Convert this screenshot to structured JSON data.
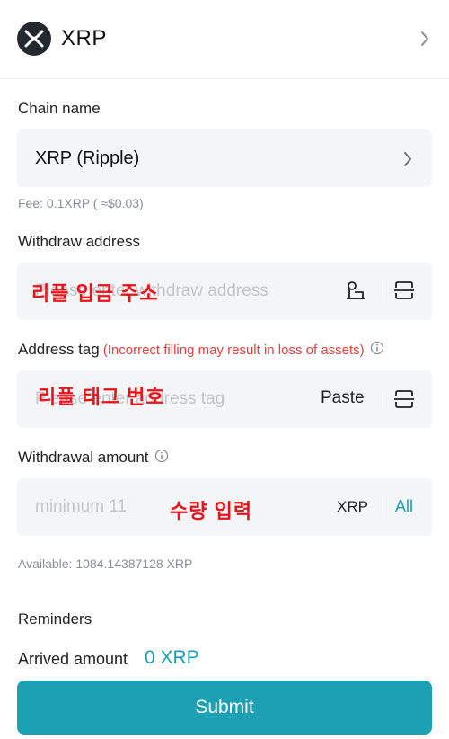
{
  "header": {
    "coin_name": "XRP",
    "logo_icon": "xrp-logo",
    "chevron_icon": "chevron-right-icon"
  },
  "chain": {
    "label": "Chain name",
    "value": "XRP (Ripple)",
    "fee": "Fee: 0.1XRP ( ≈$0.03)"
  },
  "withdraw_address": {
    "label": "Withdraw address",
    "placeholder": "Please enter withdraw address",
    "overlay_annotation": "리플 입금 주소",
    "address_book_icon": "address-book-icon",
    "scan_icon": "scan-icon"
  },
  "address_tag": {
    "label": "Address tag",
    "warning": "(Incorrect filling may result in loss of assets)",
    "placeholder": "Please enter address tag",
    "overlay_annotation": "리플 태그 번호",
    "paste_label": "Paste",
    "scan_icon": "scan-icon"
  },
  "withdrawal_amount": {
    "label": "Withdrawal amount",
    "placeholder": "minimum 11",
    "overlay_annotation": "수량 입력",
    "unit": "XRP",
    "all_label": "All",
    "available": "Available: 1084.14387128 XRP"
  },
  "reminders": {
    "label": "Reminders"
  },
  "footer": {
    "arrived_label": "Arrived amount",
    "arrived_value": "0 XRP",
    "submit_label": "Submit"
  },
  "colors": {
    "accent": "#1ba0b4",
    "warning": "#e0413d",
    "annotation": "#e8141b",
    "field_bg": "#f4f5f6"
  }
}
